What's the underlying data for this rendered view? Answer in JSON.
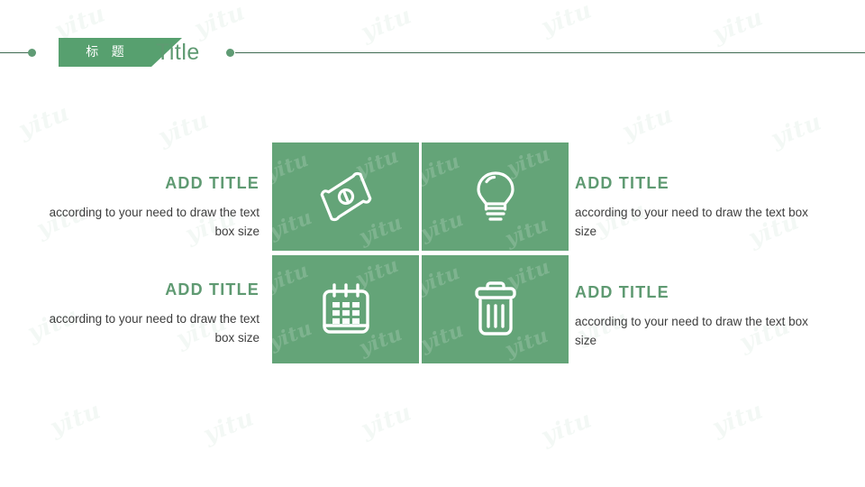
{
  "header": {
    "banner_label": "标 题",
    "title": "Title",
    "line_color": "#3f6b52",
    "dot_color": "#5f9b74",
    "banner_color": "#57a06f",
    "title_color": "#5f9a72"
  },
  "theme": {
    "tile_green": "#64a478",
    "accent_green": "#5f9a72",
    "body_text": "#3d3d3d",
    "background": "#ffffff"
  },
  "watermark": {
    "text": "yitu"
  },
  "tiles": [
    {
      "icon": "money-bill-icon",
      "position": "top-left"
    },
    {
      "icon": "lightbulb-icon",
      "position": "top-right"
    },
    {
      "icon": "calendar-icon",
      "position": "bottom-left"
    },
    {
      "icon": "trash-can-icon",
      "position": "bottom-right"
    }
  ],
  "blocks": {
    "left": [
      {
        "title": "ADD TITLE",
        "body": "according to your need to draw the text box size"
      },
      {
        "title": "ADD TITLE",
        "body": "according to your need to draw the text box size"
      }
    ],
    "right": [
      {
        "title": "ADD TITLE",
        "body": "according to your need to draw the text box size"
      },
      {
        "title": "ADD TITLE",
        "body": "according to your need to draw the text box size"
      }
    ]
  }
}
